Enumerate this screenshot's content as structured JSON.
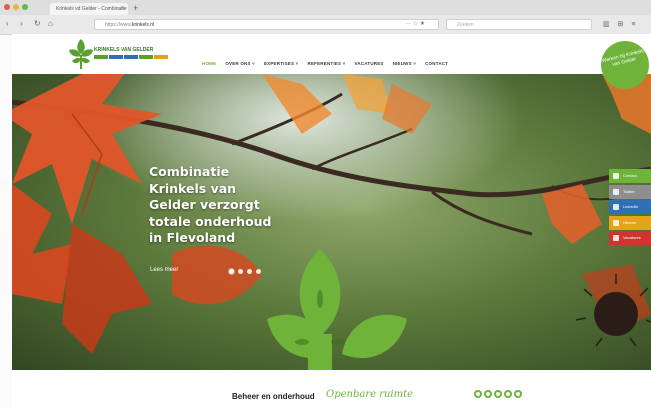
{
  "browser": {
    "tab_title": "Krinkels vd Gelder - Combinatie",
    "tab_close": "×",
    "new_tab": "+",
    "back": "‹",
    "forward": "›",
    "reload": "↻",
    "home": "⌂",
    "url_prefix": "https://www.",
    "url_domain": "krinkels.nl",
    "url_icons": "··· ☆ ★",
    "search_placeholder": "Zoeken",
    "toolbar_icons": "▥ ⊞ ≡"
  },
  "site": {
    "logo_text": "KRINKELS VAN GELDER",
    "logo_colors": [
      "#5aa02c",
      "#2f6fb5",
      "#2f6fb5",
      "#5aa02c",
      "#e3a21a"
    ],
    "nav": [
      "HOME",
      "OVER ONS ˅",
      "EXPERTISES ˅",
      "REFERENTIES ˅",
      "VACATURES",
      "NIEUWS ˅",
      "CONTACT"
    ],
    "badge_text": "Werken bij Krinkels van Gelder",
    "hero_title": [
      "Combinatie",
      "Krinkels van",
      "Gelder verzorgt",
      "totale onderhoud",
      "in Flevoland"
    ],
    "lees_meer": "Lees meer",
    "side_tabs": [
      {
        "label": "Contact",
        "color": "#6fb33b"
      },
      {
        "label": "Twitter",
        "color": "#8e8e8e"
      },
      {
        "label": "LinkedIn",
        "color": "#2f6fb5"
      },
      {
        "label": "Nieuws",
        "color": "#e6a21a"
      },
      {
        "label": "Vacatures",
        "color": "#d0342c"
      }
    ],
    "bottom_title": "Beheer en onderhoud",
    "bottom_script": "Openbare ruimte"
  },
  "colors": {
    "accent": "#6fb33b",
    "brand_blue": "#2f6fb5"
  }
}
